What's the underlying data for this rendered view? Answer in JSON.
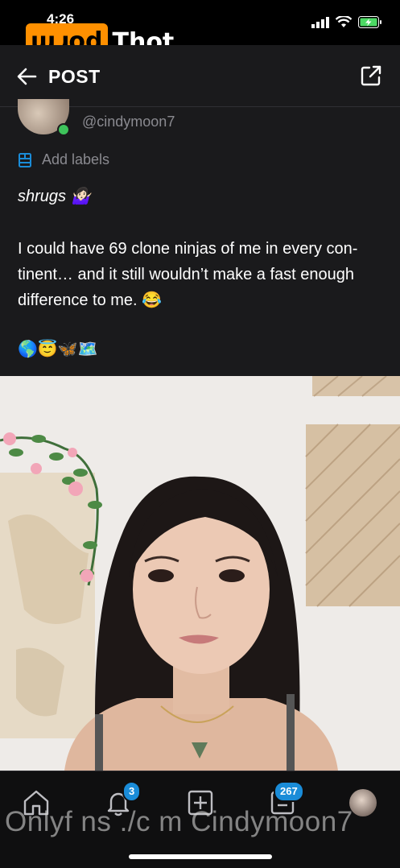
{
  "status_bar": {
    "time": "4:26",
    "icons": [
      "signal-icon",
      "wifi-icon",
      "battery-charging-icon"
    ]
  },
  "watermark_logo": {
    "box_text": "porn",
    "text": "Thot",
    "display_mirrored": "ɯɹod"
  },
  "header": {
    "title": "POST",
    "back_icon": "arrow-left-icon",
    "share_icon": "share-icon"
  },
  "post": {
    "username": "@cindymoon7",
    "labels_text": "Add labels",
    "italic_line": "shrugs 🤷🏻‍♀️",
    "body": "I could have 69 clone ninjas of me in every con-tinent… and it still wouldn’t make a fast enough difference to me. 😂",
    "emojis": "🌎😇🦋🗺️"
  },
  "bottom_nav": {
    "notifications_badge": "3",
    "messages_badge": "267",
    "overlay_watermark": "Onlyf ns ./c m Cindymoon7"
  },
  "colors": {
    "background": "#1a1a1c",
    "accent": "#1a8cd8",
    "online": "#3ec35b",
    "logo": "#ff9000"
  }
}
